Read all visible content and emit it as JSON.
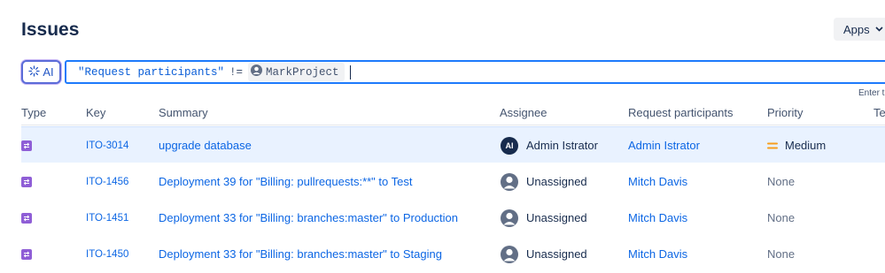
{
  "page": {
    "title": "Issues"
  },
  "apps_button": {
    "label": "Apps",
    "icon": "chevron-down-icon"
  },
  "search": {
    "ai_label": "AI",
    "ai_icon": "sparkle-icon",
    "query_field": "\"Request participants\"",
    "query_operator": "!=",
    "query_user": "MarkProject",
    "hint": "Enter t"
  },
  "columns": {
    "type": "Type",
    "key": "Key",
    "summary": "Summary",
    "assignee": "Assignee",
    "participants": "Request participants",
    "priority": "Priority",
    "team": "Tea"
  },
  "rows": [
    {
      "key": "ITO-3014",
      "summary": "upgrade database",
      "assignee": "Admin Istrator",
      "assignee_initials": "AI",
      "participant": "Admin Istrator",
      "priority": "Medium"
    },
    {
      "key": "ITO-1456",
      "summary": "Deployment 39 for \"Billing: pullrequests:**\" to Test",
      "assignee": "Unassigned",
      "participant": "Mitch Davis",
      "priority": "None"
    },
    {
      "key": "ITO-1451",
      "summary": "Deployment 33 for \"Billing: branches:master\" to Production",
      "assignee": "Unassigned",
      "participant": "Mitch Davis",
      "priority": "None"
    },
    {
      "key": "ITO-1450",
      "summary": "Deployment 33 for \"Billing: branches:master\" to Staging",
      "assignee": "Unassigned",
      "participant": "Mitch Davis",
      "priority": "None"
    }
  ],
  "colors": {
    "link": "#0c66e4",
    "type_icon": "#8f5ed6",
    "medium_priority": "#f79e1b",
    "selected_row": "#e9f2ff"
  }
}
